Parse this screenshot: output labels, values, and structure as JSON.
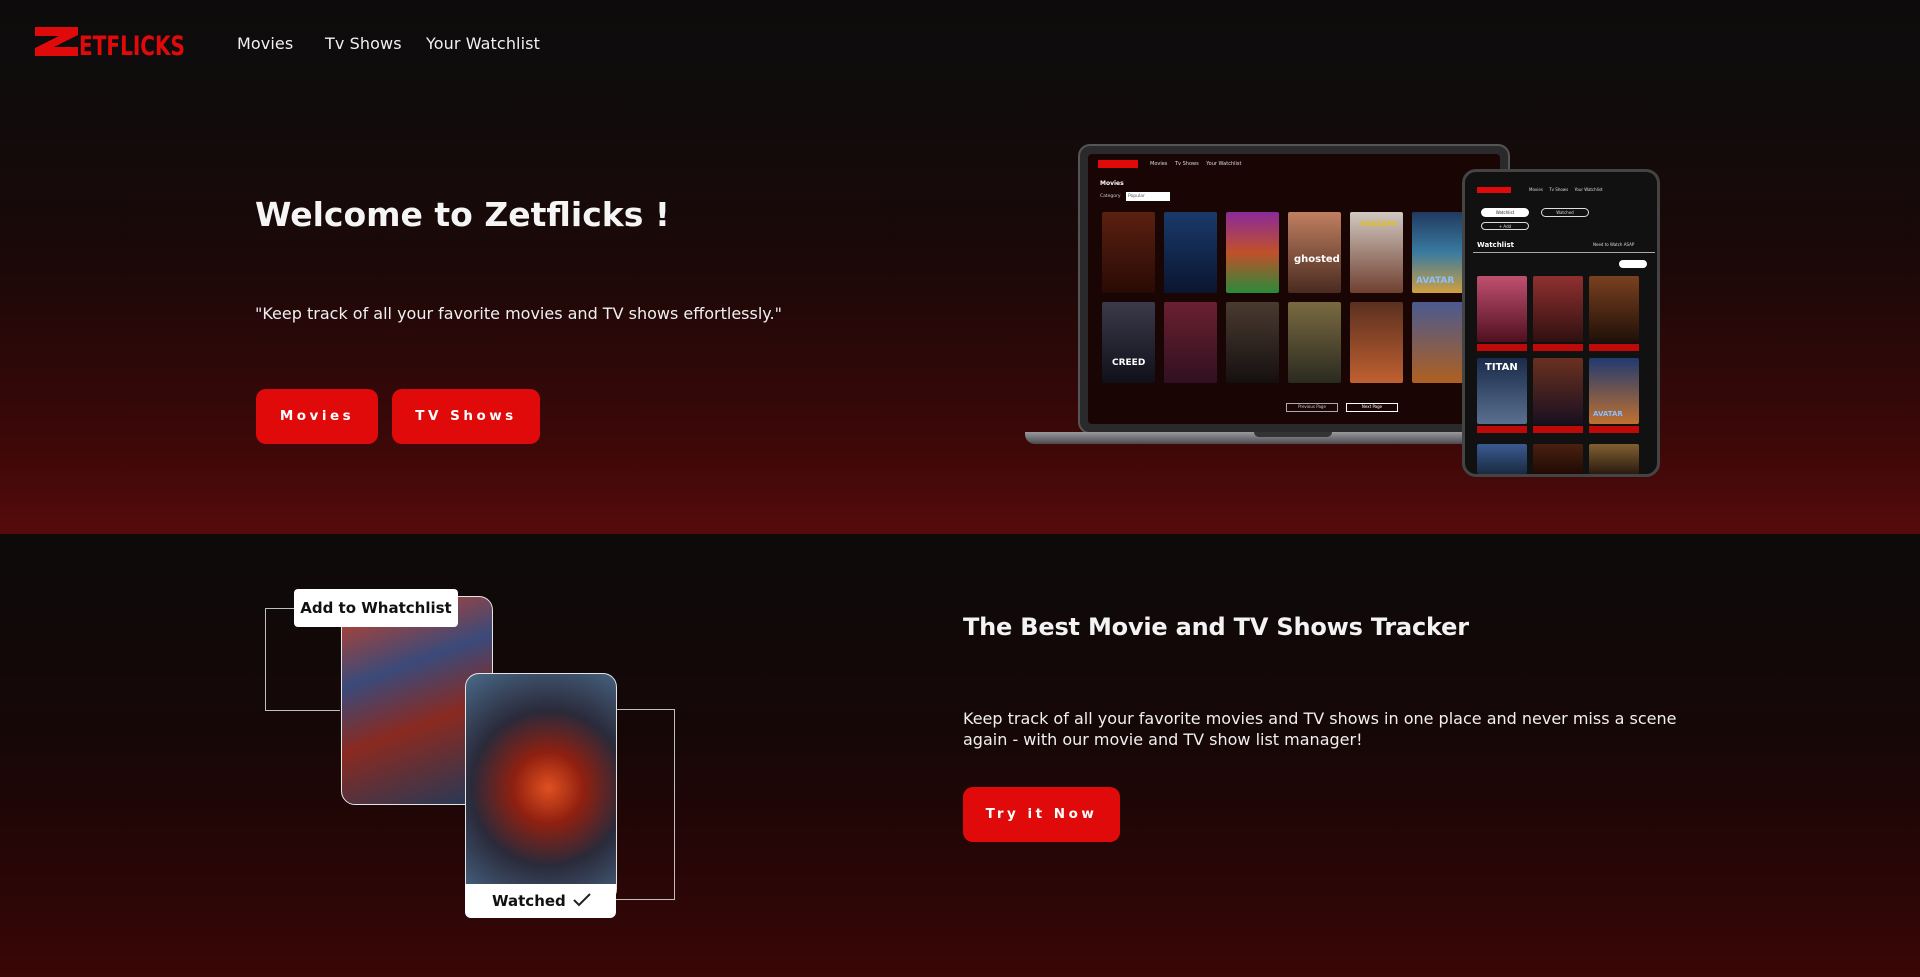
{
  "brand": {
    "name": "ZETFLICKS",
    "color": "#e00a0a"
  },
  "nav": {
    "links": [
      {
        "label": "Movies"
      },
      {
        "label": "Tv Shows"
      },
      {
        "label": "Your Watchlist"
      }
    ]
  },
  "hero": {
    "title": "Welcome to Zetflicks !",
    "subtitle": "\"Keep track of all your favorite movies and TV shows effortlessly.\"",
    "buttons": [
      {
        "label": "Movies"
      },
      {
        "label": "TV Shows"
      }
    ]
  },
  "mockup": {
    "laptop": {
      "nav_links": [
        "Movies",
        "Tv Shows",
        "Your Watchlist"
      ],
      "heading": "Movies",
      "category_label": "Category",
      "category_value": "Popular",
      "pagination": [
        "Previous Page",
        "Next Page"
      ],
      "poster_titles": [
        "",
        "",
        "",
        "ghosted",
        "SHAZAM!",
        "AVATAR",
        "CREED",
        "",
        "",
        "",
        "",
        ""
      ]
    },
    "tablet": {
      "nav_links": [
        "Movies",
        "Tv Shows",
        "Your Watchlist"
      ],
      "tabs": [
        "Watchlist",
        "Watched"
      ],
      "add_label": "+ Add",
      "heading": "Watchlist",
      "sort_label": "Need to Watch ASAP",
      "poster_titles": [
        "",
        "",
        "",
        "TITAN",
        "",
        "AVATAR"
      ]
    }
  },
  "feature": {
    "title": "The Best Movie and TV Shows Tracker",
    "text": "Keep track of all your favorite movies and TV shows in one place and never miss a scene again - with our movie and TV show list manager!",
    "button": "Try it Now",
    "tags": {
      "watchlist": "Add to Whatchlist",
      "watched": "Watched"
    },
    "check_icon": "checkmark-icon"
  },
  "colors": {
    "accent": "#e00a0a",
    "background": "#0c0a0a",
    "hero_bottom": "#560a0a"
  }
}
